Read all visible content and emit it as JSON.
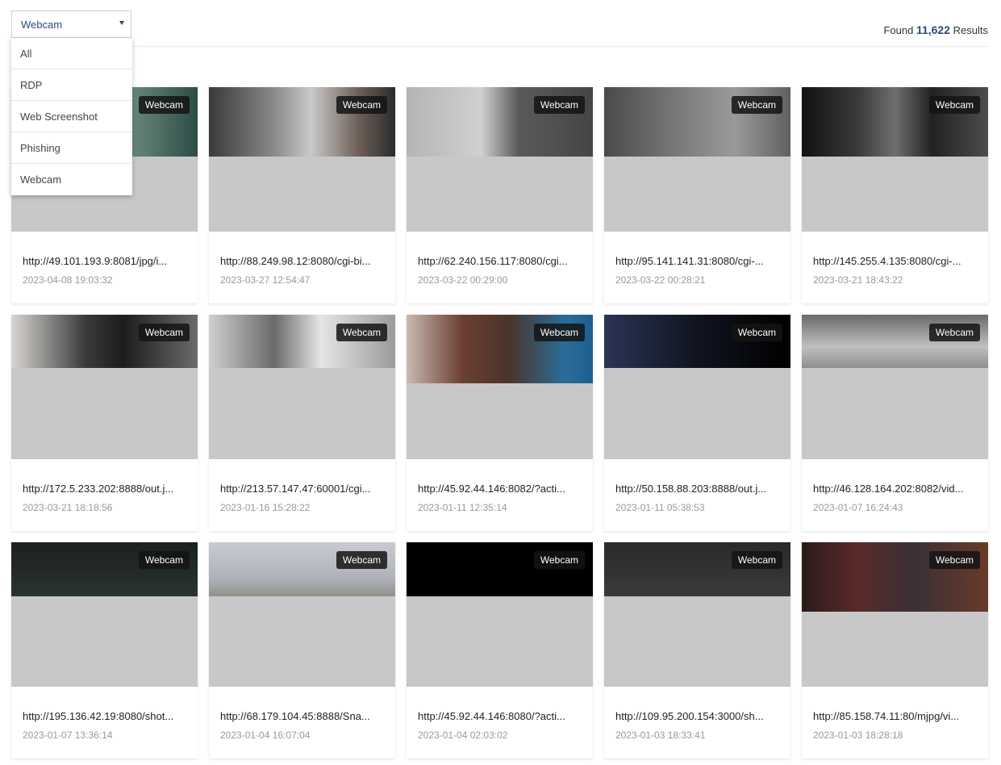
{
  "filter": {
    "selected": "Webcam",
    "options": [
      "All",
      "RDP",
      "Web Screenshot",
      "Phishing",
      "Webcam"
    ]
  },
  "results": {
    "prefix": "Found",
    "count": "11,622",
    "suffix": "Results"
  },
  "cards": [
    {
      "tag": "Webcam",
      "url": "http://49.101.193.9:8081/jpg/i...",
      "date": "2023-04-08 19:03:32"
    },
    {
      "tag": "Webcam",
      "url": "http://88.249.98.12:8080/cgi-bi...",
      "date": "2023-03-27 12:54:47"
    },
    {
      "tag": "Webcam",
      "url": "http://62.240.156.117:8080/cgi...",
      "date": "2023-03-22 00:29:00"
    },
    {
      "tag": "Webcam",
      "url": "http://95.141.141.31:8080/cgi-...",
      "date": "2023-03-22 00:28:21"
    },
    {
      "tag": "Webcam",
      "url": "http://145.255.4.135:8080/cgi-...",
      "date": "2023-03-21 18:43:22"
    },
    {
      "tag": "Webcam",
      "url": "http://172.5.233.202:8888/out.j...",
      "date": "2023-03-21 18:18:56"
    },
    {
      "tag": "Webcam",
      "url": "http://213.57.147.47:60001/cgi...",
      "date": "2023-01-16 15:28:22"
    },
    {
      "tag": "Webcam",
      "url": "http://45.92.44.146:8082/?acti...",
      "date": "2023-01-11 12:35:14"
    },
    {
      "tag": "Webcam",
      "url": "http://50.158.88.203:8888/out.j...",
      "date": "2023-01-11 05:38:53"
    },
    {
      "tag": "Webcam",
      "url": "http://46.128.164.202:8082/vid...",
      "date": "2023-01-07 16:24:43"
    },
    {
      "tag": "Webcam",
      "url": "http://195.136.42.19:8080/shot...",
      "date": "2023-01-07 13:36:14"
    },
    {
      "tag": "Webcam",
      "url": "http://68.179.104.45:8888/Sna...",
      "date": "2023-01-04 16:07:04"
    },
    {
      "tag": "Webcam",
      "url": "http://45.92.44.146:8080/?acti...",
      "date": "2023-01-04 02:03:02"
    },
    {
      "tag": "Webcam",
      "url": "http://109.95.200.154:3000/sh...",
      "date": "2023-01-03 18:33:41"
    },
    {
      "tag": "Webcam",
      "url": "http://85.158.74.11:80/mjpg/vi...",
      "date": "2023-01-03 18:28:18"
    }
  ]
}
